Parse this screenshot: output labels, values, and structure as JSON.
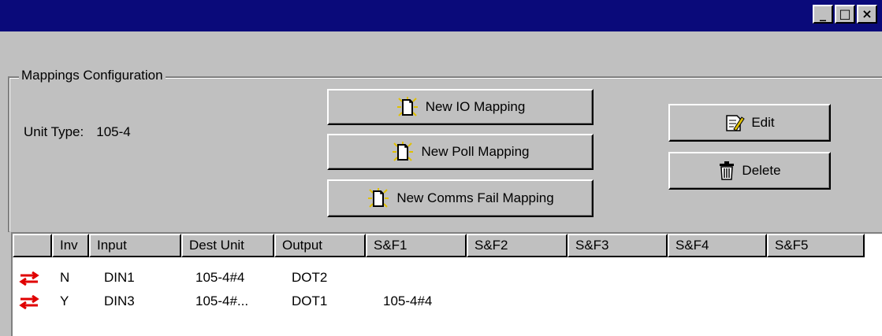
{
  "window": {
    "controls": [
      {
        "name": "minimize-icon",
        "glyph": "_"
      },
      {
        "name": "maximize-icon",
        "glyph": "□"
      },
      {
        "name": "close-icon",
        "glyph": "×"
      }
    ]
  },
  "group": {
    "title": "Mappings Configuration",
    "unit_type_label": "Unit Type:",
    "unit_type_value": "105-4"
  },
  "buttons": {
    "new_io": "New IO Mapping",
    "new_poll": "New Poll Mapping",
    "new_comms_fail": "New Comms Fail Mapping",
    "edit": "Edit",
    "delete": "Delete"
  },
  "icons": {
    "new_mapping": "new-document-icon",
    "edit": "edit-document-icon",
    "delete": "trash-can-icon",
    "row_status": "bidirectional-arrows-icon",
    "row_status_color": "#e00000"
  },
  "table": {
    "columns": [
      "",
      "Inv",
      "Input",
      "Dest Unit",
      "Output",
      "S&F1",
      "S&F2",
      "S&F3",
      "S&F4",
      "S&F5"
    ],
    "rows": [
      {
        "inv": "N",
        "input": "DIN1",
        "dest_unit": "105-4#4",
        "output": "DOT2",
        "sf1": "",
        "sf2": "",
        "sf3": "",
        "sf4": "",
        "sf5": ""
      },
      {
        "inv": "Y",
        "input": "DIN3",
        "dest_unit": "105-4#...",
        "output": "DOT1",
        "sf1": "105-4#4",
        "sf2": "",
        "sf3": "",
        "sf4": "",
        "sf5": ""
      }
    ]
  }
}
